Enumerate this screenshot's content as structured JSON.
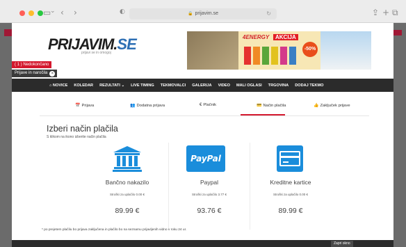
{
  "browser": {
    "url": "prijavim.se",
    "lock_icon": "🔒",
    "reload_icon": "↻"
  },
  "header": {
    "logo_main": "PRIJAVIM.",
    "logo_se": "SE",
    "logo_tagline": "prijavi se in omogoj",
    "banner": {
      "brand": "4ENERGY",
      "promo": "AKCIJA",
      "discount": "-50%"
    }
  },
  "badges": {
    "unfinished": "( 1 ) Nedokončano",
    "orders": "Prijave in naročila"
  },
  "nav": {
    "items": [
      "⌂ NOVICE",
      "KOLEDAR",
      "REZULTATI ⌄",
      "LIVE TIMING",
      "TEKMOVALCI",
      "GALERIJA",
      "VIDEO",
      "MALI OGLASI",
      "TRGOVINA",
      "DODAJ TEKMO"
    ]
  },
  "steps": {
    "items": [
      {
        "icon": "📅",
        "label": "Prijava"
      },
      {
        "icon": "👥",
        "label": "Dodatna prijava"
      },
      {
        "icon": "€",
        "label": "Plačnik"
      },
      {
        "icon": "💳",
        "label": "Način plačila"
      },
      {
        "icon": "👍",
        "label": "Zaključek prijave"
      }
    ],
    "active_index": 3
  },
  "main": {
    "heading": "Izberi način plačila",
    "subheading": "S klikom na ikono izberite način plačila",
    "methods": [
      {
        "icon": "bank-icon",
        "name": "Bančno nakazilo",
        "fee": "Stroški za uplačilo 0.00 €",
        "price": "89.99 €"
      },
      {
        "icon": "paypal-icon",
        "icon_text": "PayPal",
        "name": "Paypal",
        "fee": "Stroški za uplačilo 3.77 €",
        "price": "93.76 €"
      },
      {
        "icon": "credit-card-icon",
        "name": "Kreditne kartice",
        "fee": "Stroški za uplačilo 0.00 €",
        "price": "89.99 €"
      }
    ],
    "footnote": "* po prejetem plačilu bo prijava zaključena in plačilo bo na seznamu prijavljenih vidno v roku 24 ur."
  },
  "footer": {
    "button": "Zapri okno"
  },
  "colors": {
    "accent_red": "#d4182e",
    "paypal_blue": "#1a8ddb",
    "nav_dark": "#2b2b2b"
  }
}
